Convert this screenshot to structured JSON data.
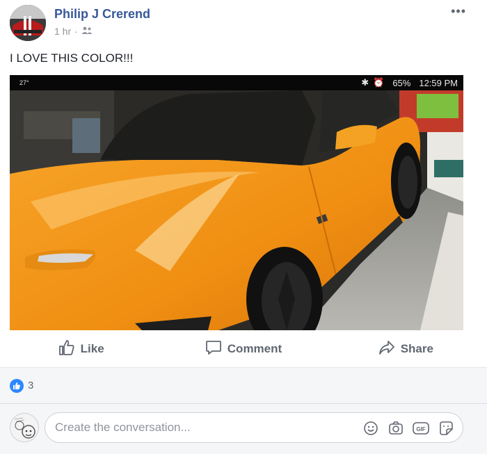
{
  "post": {
    "author": "Philip J Crerend",
    "time": "1 hr",
    "separator": "·",
    "audience_icon": "friends-icon",
    "more_label": "•••",
    "text": "I LOVE THIS COLOR!!!"
  },
  "photo": {
    "status_left": "27°",
    "status_battery": "65%",
    "status_time": "12:59 PM"
  },
  "actions": {
    "like": "Like",
    "comment": "Comment",
    "share": "Share"
  },
  "reactions": {
    "like_count": "3"
  },
  "composer": {
    "placeholder": "Create the conversation..."
  },
  "colors": {
    "link": "#385898",
    "like_blue": "#2d88ff",
    "car_orange": "#f29a1a"
  }
}
